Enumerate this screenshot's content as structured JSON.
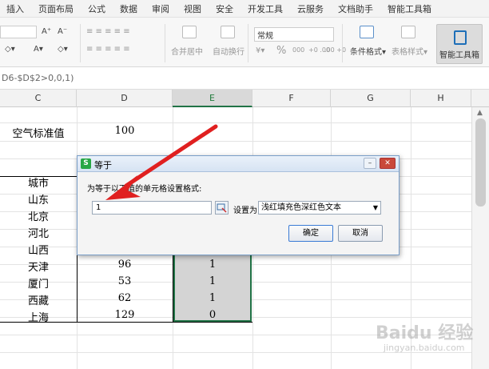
{
  "menu": [
    "插入",
    "页面布局",
    "公式",
    "数据",
    "审阅",
    "视图",
    "安全",
    "开发工具",
    "云服务",
    "文档助手",
    "智能工具箱"
  ],
  "ribbon": {
    "font_size_up": "A⁺",
    "font_size_down": "A⁻",
    "merge_center": "合并居中",
    "auto_wrap": "自动换行",
    "number_format": "常规",
    "percent": "%",
    "thousand": "000",
    "dec_inc": "+0 .00",
    "dec_dec": ".00 +0",
    "cond_format": "条件格式",
    "table_style": "表格样式",
    "smart_toolbox": "智能工具箱"
  },
  "formula_bar": {
    "text": "D6-$D$2>0,0,1)"
  },
  "columns": [
    "C",
    "D",
    "E",
    "F",
    "G",
    "H"
  ],
  "cells": {
    "c2": "空气标准值",
    "d2": "100",
    "c4": "城市",
    "c5": "山东",
    "c6": "北京",
    "c7": "河北",
    "c8": "山西",
    "c9": "天津",
    "d9": "96",
    "e9": "1",
    "c10": "厦门",
    "d10": "53",
    "e10": "1",
    "c11": "西藏",
    "d11": "62",
    "e11": "1",
    "c12": "上海",
    "d12": "129",
    "e12": "0"
  },
  "dialog": {
    "title": "等于",
    "prompt": "为等于以下值的单元格设置格式:",
    "value": "1",
    "set_as_label": "设置为",
    "format_selected": "浅红填充色深红色文本",
    "ok": "确定",
    "cancel": "取消"
  },
  "watermark": "Baidu 经验",
  "watermark_sub": "jingyan.baidu.com",
  "colors": {
    "selection_border": "#217346",
    "selected_fill": "#d4d4d4",
    "arrow": "#e02020",
    "dialog_border": "#7a9ec8"
  }
}
